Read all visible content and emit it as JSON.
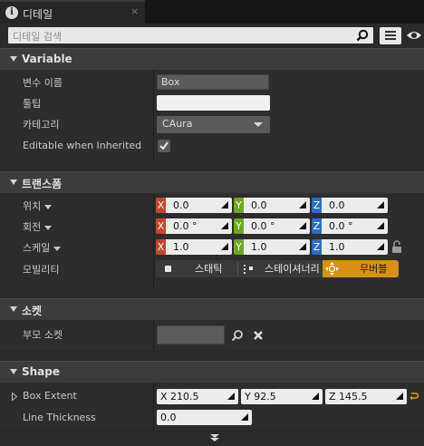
{
  "tab": {
    "icon": "info-icon",
    "icon_glyph": "i",
    "label": "디테일",
    "close_glyph": "×"
  },
  "search": {
    "placeholder": "디테일 검색"
  },
  "categories": {
    "variable": "Variable",
    "transform": "트랜스폼",
    "socket": "소켓",
    "shape": "Shape"
  },
  "variable": {
    "name_label": "변수 이름",
    "name_value": "Box",
    "tooltip_label": "툴팁",
    "tooltip_value": "",
    "category_label": "카테고리",
    "category_value": "CAura",
    "editable_label": "Editable when Inherited",
    "editable_checked": true
  },
  "transform": {
    "location_label": "위치",
    "rotation_label": "회전",
    "scale_label": "스케일",
    "mobility_label": "모빌리티",
    "axis_letters": [
      "X",
      "Y",
      "Z"
    ],
    "location": [
      "0.0",
      "0.0",
      "0.0"
    ],
    "rotation": [
      "0.0 °",
      "0.0 °",
      "0.0 °"
    ],
    "scale": [
      "1.0",
      "1.0",
      "1.0"
    ],
    "mobility_options": [
      "스태틱",
      "스테이셔너리",
      "무버블"
    ],
    "mobility_selected": "무버블"
  },
  "socket": {
    "parent_label": "부모 소켓",
    "parent_value": ""
  },
  "shape": {
    "box_extent_label": "Box Extent",
    "box_extent": [
      "X  210.5",
      "Y  92.5",
      "Z  145.5"
    ],
    "line_thickness_label": "Line Thickness",
    "line_thickness": "0.0"
  },
  "colors": {
    "x_axis": "#c6452e",
    "y_axis": "#71a61f",
    "z_axis": "#2e6bc6",
    "mobility_active": "#d98f10"
  }
}
